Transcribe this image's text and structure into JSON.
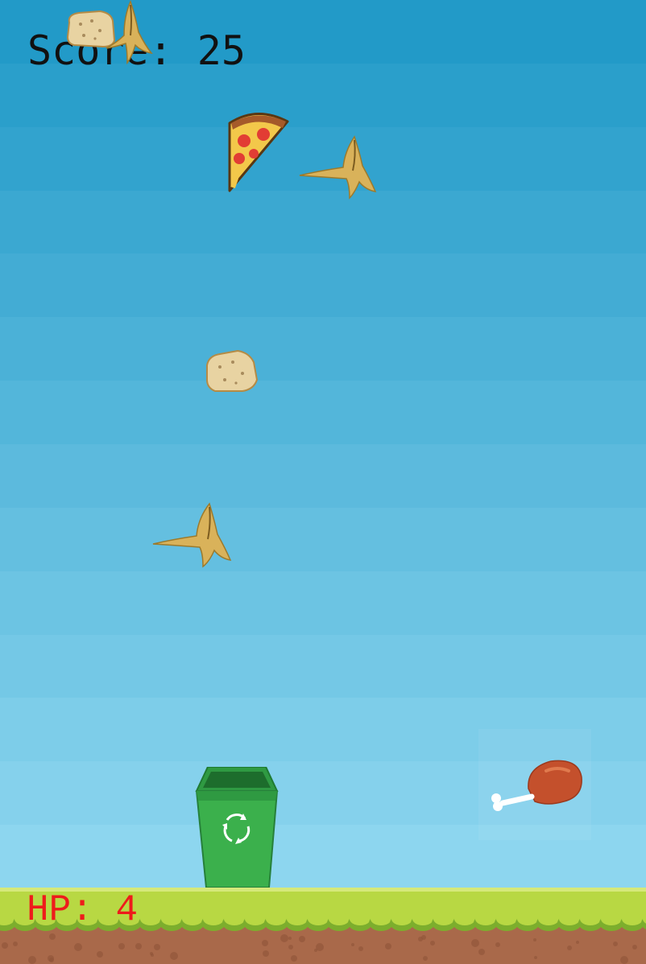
{
  "hud": {
    "score_label": "Score:",
    "score_value": "25",
    "hp_label": "HP:",
    "hp_value": "4"
  },
  "colors": {
    "sky_top": "#229ac8",
    "sky_bottom": "#8dd6ef",
    "score_text": "#111111",
    "hp_text": "#ee1b1b",
    "grass": "#b8d843",
    "grass_dark": "#7cae2d",
    "dirt": "#a9694a",
    "bin_green": "#3bb04c",
    "bin_dark": "#26803a"
  },
  "sprites": {
    "falling": [
      {
        "kind": "toast",
        "icon": "toast-icon"
      },
      {
        "kind": "banana-peel",
        "icon": "banana-peel-icon"
      },
      {
        "kind": "pizza-slice",
        "icon": "pizza-slice-icon"
      },
      {
        "kind": "banana-peel",
        "icon": "banana-peel-icon"
      },
      {
        "kind": "toast",
        "icon": "toast-icon"
      },
      {
        "kind": "banana-peel",
        "icon": "banana-peel-icon"
      },
      {
        "kind": "chicken-leg",
        "icon": "chicken-leg-icon"
      }
    ],
    "player": {
      "kind": "recycle-bin",
      "icon": "recycle-bin-icon"
    }
  }
}
